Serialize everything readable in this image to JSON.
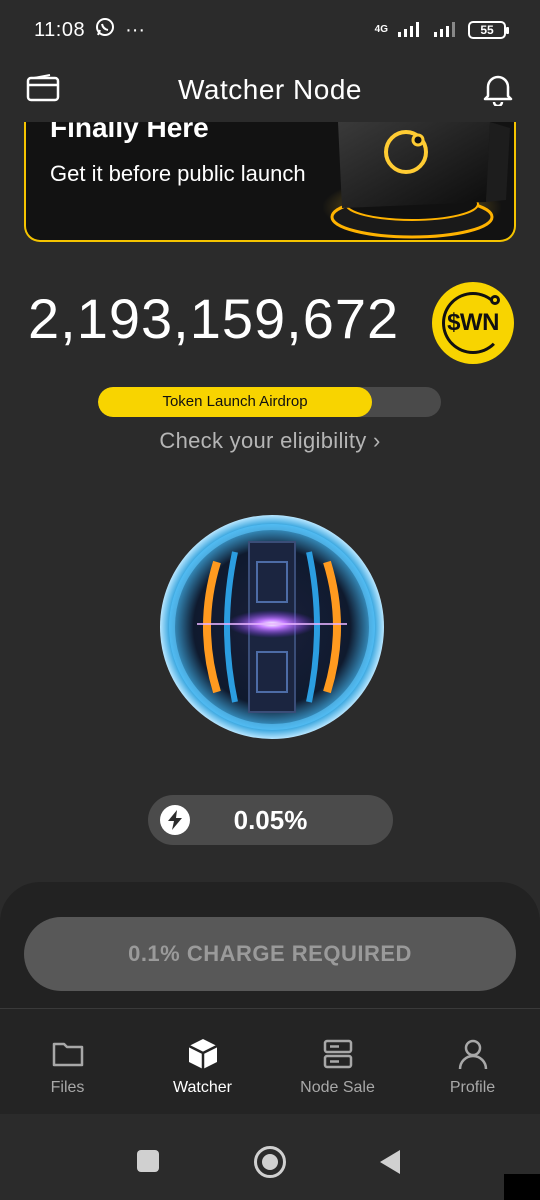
{
  "status_bar": {
    "time": "11:08",
    "more": "···",
    "network": "4G",
    "battery": "55"
  },
  "header": {
    "title": "Watcher Node"
  },
  "banner": {
    "heading": "Finally Here",
    "subtitle": "Get it before public launch"
  },
  "balance": {
    "value": "2,193,159,672",
    "token": "$WN"
  },
  "airdrop": {
    "label": "Token Launch Airdrop",
    "progress_fraction": 0.8,
    "eligibility_link": "Check your eligibility ›"
  },
  "boost": {
    "value": "0.05%"
  },
  "charge_button": {
    "label": "0.1% CHARGE REQUIRED"
  },
  "nav": {
    "items": [
      {
        "label": "Files",
        "icon": "folder-icon",
        "active": false
      },
      {
        "label": "Watcher",
        "icon": "cube-icon",
        "active": true
      },
      {
        "label": "Node Sale",
        "icon": "server-icon",
        "active": false
      },
      {
        "label": "Profile",
        "icon": "user-icon",
        "active": false
      }
    ]
  },
  "colors": {
    "background": "#2b2b2b",
    "accent": "#f8d400",
    "panel": "#222222",
    "button_disabled": "#585858"
  }
}
